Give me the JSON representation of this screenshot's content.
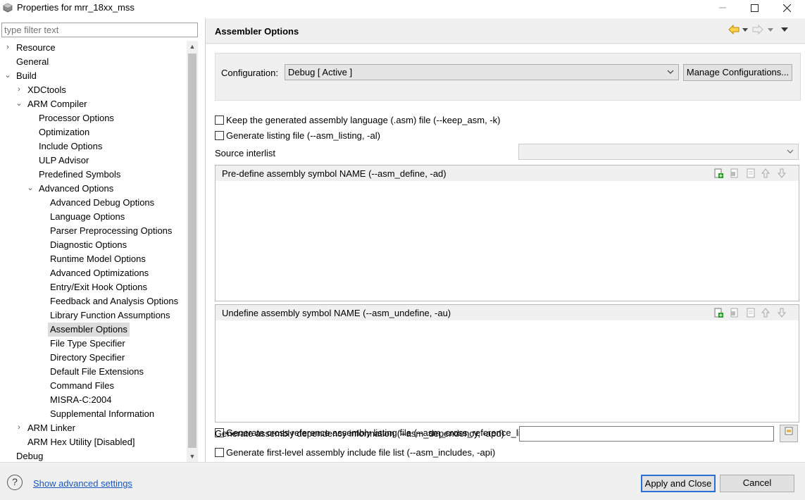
{
  "window": {
    "title": "Properties for mrr_18xx_mss",
    "minimize": "—",
    "maximize": "☐",
    "close": "✕"
  },
  "filter": {
    "placeholder": "type filter text"
  },
  "tree": [
    {
      "label": "Resource",
      "twisty": "›"
    },
    {
      "label": "General",
      "twisty": ""
    },
    {
      "label": "Build",
      "twisty": "⌄"
    },
    {
      "label": "XDCtools",
      "twisty": "›"
    },
    {
      "label": "ARM Compiler",
      "twisty": "⌄"
    },
    {
      "label": "Processor Options",
      "twisty": ""
    },
    {
      "label": "Optimization",
      "twisty": ""
    },
    {
      "label": "Include Options",
      "twisty": ""
    },
    {
      "label": "ULP Advisor",
      "twisty": ""
    },
    {
      "label": "Predefined Symbols",
      "twisty": ""
    },
    {
      "label": "Advanced Options",
      "twisty": "⌄"
    },
    {
      "label": "Advanced Debug Options",
      "twisty": ""
    },
    {
      "label": "Language Options",
      "twisty": ""
    },
    {
      "label": "Parser Preprocessing Options",
      "twisty": ""
    },
    {
      "label": "Diagnostic Options",
      "twisty": ""
    },
    {
      "label": "Runtime Model Options",
      "twisty": ""
    },
    {
      "label": "Advanced Optimizations",
      "twisty": ""
    },
    {
      "label": "Entry/Exit Hook Options",
      "twisty": ""
    },
    {
      "label": "Feedback and Analysis Options",
      "twisty": ""
    },
    {
      "label": "Library Function Assumptions",
      "twisty": ""
    },
    {
      "label": "Assembler Options",
      "twisty": "",
      "selected": true
    },
    {
      "label": "File Type Specifier",
      "twisty": ""
    },
    {
      "label": "Directory Specifier",
      "twisty": ""
    },
    {
      "label": "Default File Extensions",
      "twisty": ""
    },
    {
      "label": "Command Files",
      "twisty": ""
    },
    {
      "label": "MISRA-C:2004",
      "twisty": ""
    },
    {
      "label": "Supplemental Information",
      "twisty": ""
    },
    {
      "label": "ARM Linker",
      "twisty": "›"
    },
    {
      "label": "ARM Hex Utility  [Disabled]",
      "twisty": ""
    },
    {
      "label": "Debug",
      "twisty": ""
    }
  ],
  "page": {
    "title": "Assembler Options",
    "configuration_label": "Configuration:",
    "configuration_value": "Debug  [ Active ]",
    "manage_button": "Manage Configurations...",
    "keep_asm": "Keep the generated assembly language (.asm) file (--keep_asm, -k)",
    "listing": "Generate listing file (--asm_listing, -al)",
    "source_interlist_label": "Source interlist",
    "source_interlist_value": "",
    "predefine_title": "Pre-define assembly symbol NAME (--asm_define, -ad)",
    "undefine_title": "Undefine assembly symbol NAME (--asm_undefine, -au)",
    "cross_ref": "Generate cross reference assembly listing file (--asm_cross_reference_listing)",
    "dependency_label": "Generate assembly dependency information (--asm_dependency, -apd)",
    "dependency_value": "",
    "includes": "Generate first-level assembly include file list (--asm_includes, -api)"
  },
  "bottom": {
    "help": "?",
    "advanced_link": "Show advanced settings",
    "apply": "Apply and Close",
    "cancel": "Cancel"
  },
  "icons": {
    "add": "add-icon",
    "delete": "delete-icon",
    "edit": "edit-icon",
    "move_up": "move-up-icon",
    "move_down": "move-down-icon"
  }
}
